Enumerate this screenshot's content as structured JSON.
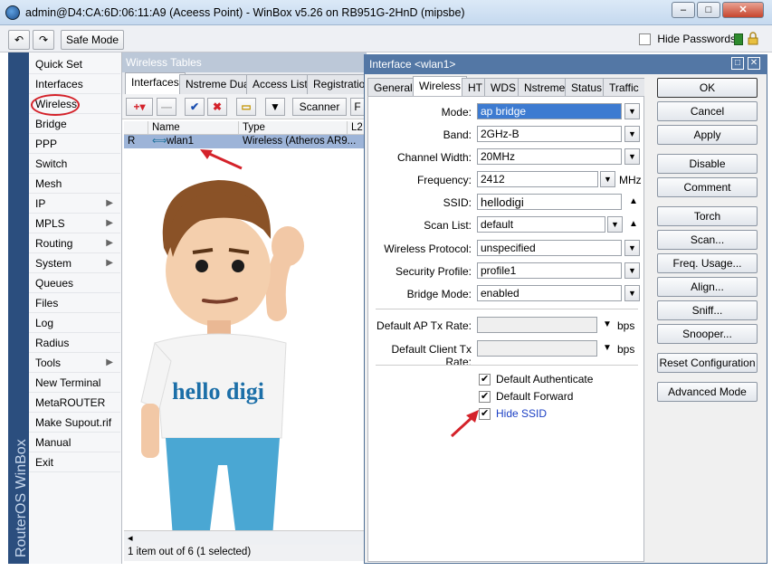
{
  "window": {
    "title": "admin@D4:CA:6D:06:11:A9 (Aceess Point) - WinBox v5.26 on RB951G-2HnD (mipsbe)",
    "min_label": "–",
    "max_label": "□",
    "close_label": "✕"
  },
  "toolbar": {
    "undo_icon": "↶",
    "redo_icon": "↷",
    "safe_mode_label": "Safe Mode",
    "hide_passwords_label": "Hide Passwords",
    "hide_passwords_checked": false
  },
  "brand": "RouterOS WinBox",
  "sidebar": {
    "items": [
      {
        "label": "Quick Set",
        "arrow": ""
      },
      {
        "label": "Interfaces",
        "arrow": ""
      },
      {
        "label": "Wireless",
        "arrow": ""
      },
      {
        "label": "Bridge",
        "arrow": ""
      },
      {
        "label": "PPP",
        "arrow": ""
      },
      {
        "label": "Switch",
        "arrow": ""
      },
      {
        "label": "Mesh",
        "arrow": ""
      },
      {
        "label": "IP",
        "arrow": "▶"
      },
      {
        "label": "MPLS",
        "arrow": "▶"
      },
      {
        "label": "Routing",
        "arrow": "▶"
      },
      {
        "label": "System",
        "arrow": "▶"
      },
      {
        "label": "Queues",
        "arrow": ""
      },
      {
        "label": "Files",
        "arrow": ""
      },
      {
        "label": "Log",
        "arrow": ""
      },
      {
        "label": "Radius",
        "arrow": ""
      },
      {
        "label": "Tools",
        "arrow": "▶"
      },
      {
        "label": "New Terminal",
        "arrow": ""
      },
      {
        "label": "MetaROUTER",
        "arrow": ""
      },
      {
        "label": "Make Supout.rif",
        "arrow": ""
      },
      {
        "label": "Manual",
        "arrow": ""
      },
      {
        "label": "Exit",
        "arrow": ""
      }
    ]
  },
  "wireless_tables": {
    "title": "Wireless Tables",
    "tabs": [
      "Interfaces",
      "Nstreme Dual",
      "Access List",
      "Registration"
    ],
    "toolbar": {
      "add": "+▾",
      "remove": "—",
      "enable": "✔",
      "disable": "✖",
      "comment": "▭",
      "filter": "▼",
      "scanner": "Scanner",
      "more": "F"
    },
    "columns": [
      "",
      "Name",
      "Type",
      "L2"
    ],
    "row": {
      "flag": "R",
      "icon": "⟺",
      "name": "wlan1",
      "type": "Wireless (Atheros AR9..."
    },
    "scroll_left": "◂",
    "status": "1 item out of 6 (1 selected)"
  },
  "illustration": {
    "shirt_text": "hello digi"
  },
  "dialog": {
    "title": "Interface <wlan1>",
    "tabs": [
      "General",
      "Wireless",
      "HT",
      "WDS",
      "Nstreme",
      "Status",
      "Traffic"
    ],
    "fields": {
      "mode": {
        "label": "Mode:",
        "value": "ap bridge"
      },
      "band": {
        "label": "Band:",
        "value": "2GHz-B"
      },
      "channel_width": {
        "label": "Channel Width:",
        "value": "20MHz"
      },
      "frequency": {
        "label": "Frequency:",
        "value": "2412",
        "unit": "MHz"
      },
      "ssid": {
        "label": "SSID:",
        "value": "hellodigi"
      },
      "scan_list": {
        "label": "Scan List:",
        "value": "default"
      },
      "wireless_protocol": {
        "label": "Wireless Protocol:",
        "value": "unspecified"
      },
      "security_profile": {
        "label": "Security Profile:",
        "value": "profile1"
      },
      "bridge_mode": {
        "label": "Bridge Mode:",
        "value": "enabled"
      },
      "default_ap_tx_rate": {
        "label": "Default AP Tx Rate:",
        "value": "",
        "unit": "bps"
      },
      "default_client_tx_rate": {
        "label": "Default Client Tx Rate:",
        "value": "",
        "unit": "bps"
      }
    },
    "checks": [
      {
        "label": "Default Authenticate",
        "checked": true
      },
      {
        "label": "Default Forward",
        "checked": true
      },
      {
        "label": "Hide SSID",
        "checked": true
      }
    ],
    "buttons": [
      "OK",
      "Cancel",
      "Apply",
      "Disable",
      "Comment",
      "Torch",
      "Scan...",
      "Freq. Usage...",
      "Align...",
      "Sniff...",
      "Snooper...",
      "Reset Configuration",
      "Advanced Mode"
    ]
  },
  "colors": {
    "brand_bar": "#2b4e7e",
    "dialog_title": "#5377a5",
    "highlight_red": "#d4222a",
    "selection": "#3d7bd1"
  }
}
